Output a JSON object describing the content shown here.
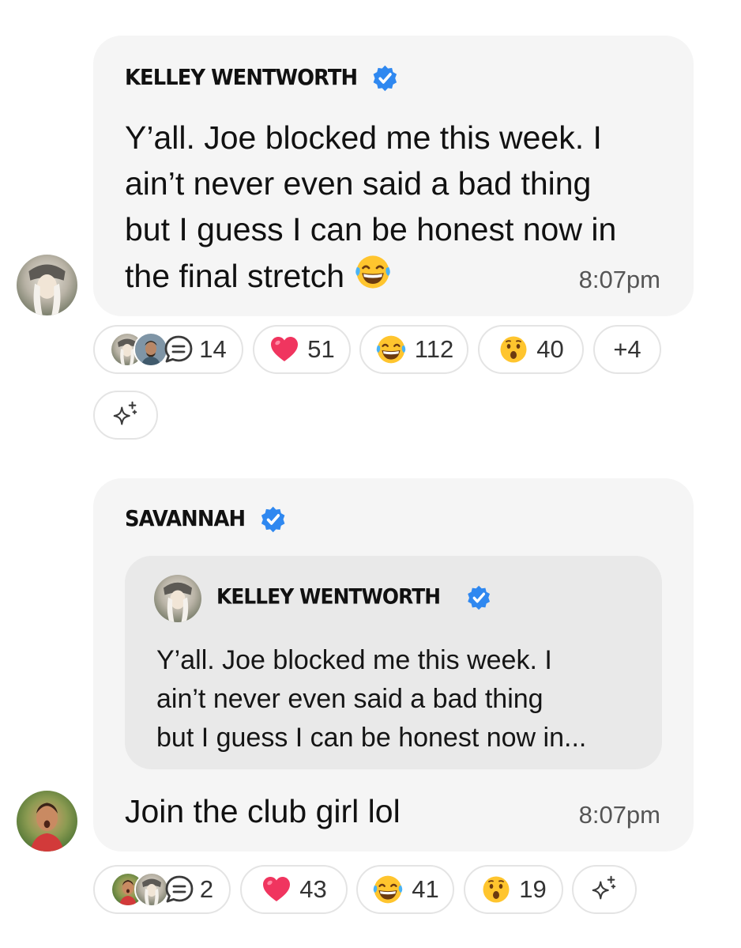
{
  "messages": [
    {
      "sender": "KELLEY WENTWORTH",
      "text_lines": [
        "Y’all. Joe blocked me this week. I",
        "ain’t never even said a bad thing",
        "but I guess I can be honest now in",
        "the final stretch"
      ],
      "emoji": "tears-of-joy-face",
      "time": "8:07pm",
      "reactions": {
        "reply_count": "14",
        "heart": "51",
        "laugh": "112",
        "wow": "40",
        "more": "+4"
      }
    },
    {
      "sender": "SAVANNAH",
      "quote": {
        "sender": "KELLEY WENTWORTH",
        "lines": [
          "Y’all. Joe blocked me this week. I",
          "ain’t never even said a bad thing",
          "but I guess I can be honest now in..."
        ]
      },
      "text": "Join the club girl lol",
      "time": "8:07pm",
      "reactions": {
        "reply_count": "2",
        "heart": "43",
        "laugh": "41",
        "wow": "19"
      }
    }
  ],
  "icons": {
    "verified": "verified-badge-icon",
    "comment": "comment-bubble-icon",
    "sparkle": "sparkle-icon"
  },
  "colors": {
    "verified_blue": "#2f88f0",
    "bubble_bg": "#f5f5f5",
    "quote_bg": "#e9e9e9",
    "pill_border": "#e4e4e4",
    "text_dark": "#111111",
    "text_muted": "#555555",
    "heart_pink": "#f0355f",
    "emoji_yellow": "#ffc52e"
  }
}
